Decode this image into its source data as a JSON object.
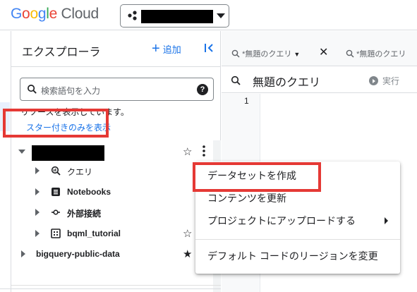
{
  "brand": {
    "logo_letters": [
      {
        "ch": "G",
        "color": "#4285F4"
      },
      {
        "ch": "o",
        "color": "#EA4335"
      },
      {
        "ch": "o",
        "color": "#FBBC05"
      },
      {
        "ch": "g",
        "color": "#4285F4"
      },
      {
        "ch": "l",
        "color": "#34A853"
      },
      {
        "ch": "e",
        "color": "#EA4335"
      }
    ],
    "product": "Cloud"
  },
  "explorer": {
    "title": "エクスプローラ",
    "add_label": "追加",
    "search_placeholder": "検索語句を入力",
    "info_text": "リソースを表示しています。",
    "starred_link": "スター付きのみを表示",
    "tree": {
      "children": [
        {
          "label": "クエリ",
          "icon": "query-icon"
        },
        {
          "label": "Notebooks",
          "icon": "notebook-icon"
        },
        {
          "label": "外部接続",
          "icon": "connection-icon"
        },
        {
          "label": "bqml_tutorial",
          "icon": "dataset-icon"
        }
      ],
      "public_project": "bigquery-public-data"
    }
  },
  "tabs": [
    {
      "label": "*無題のクエリ"
    },
    {
      "label": "*無題のクエリ"
    }
  ],
  "query": {
    "title": "無題のクエリ",
    "run_label": "実行",
    "line_number": "1"
  },
  "context_menu": {
    "items": [
      "データセットを作成",
      "コンテンツを更新",
      "プロジェクトにアップロードする",
      "デフォルト コードのリージョンを変更"
    ]
  },
  "colors": {
    "accent": "#1a73e8",
    "highlight_border": "#e53935"
  }
}
